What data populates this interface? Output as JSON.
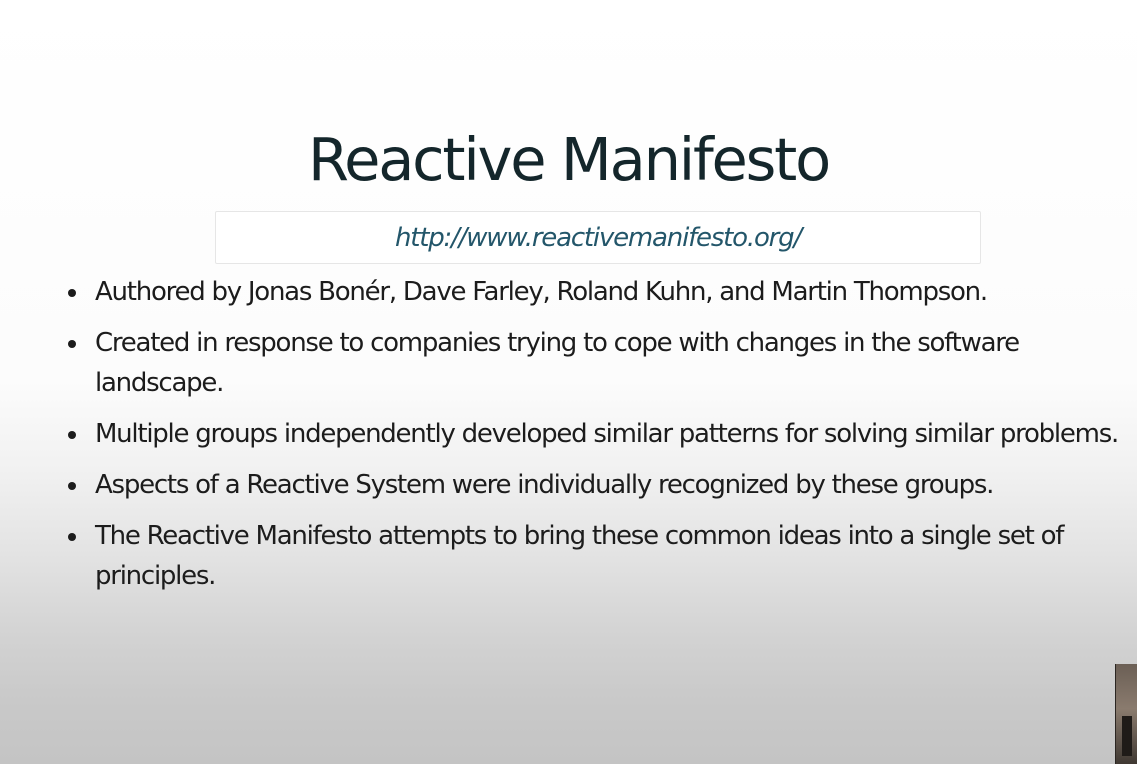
{
  "slide": {
    "title": "Reactive Manifesto",
    "url": "http://www.reactivemanifesto.org/",
    "bullets": [
      "Authored by Jonas Bonér, Dave Farley, Roland Kuhn, and Martin Thompson.",
      "Created in response to companies trying to cope with changes in the software landscape.",
      "Multiple groups independently developed similar patterns for solving similar problems.",
      "Aspects of a Reactive System were individually recognized by these groups.",
      "The Reactive Manifesto attempts to bring these common ideas into a single set of principles."
    ]
  },
  "colors": {
    "title": "#14262b",
    "link": "#23566a",
    "body_text": "#1c1c1c"
  }
}
